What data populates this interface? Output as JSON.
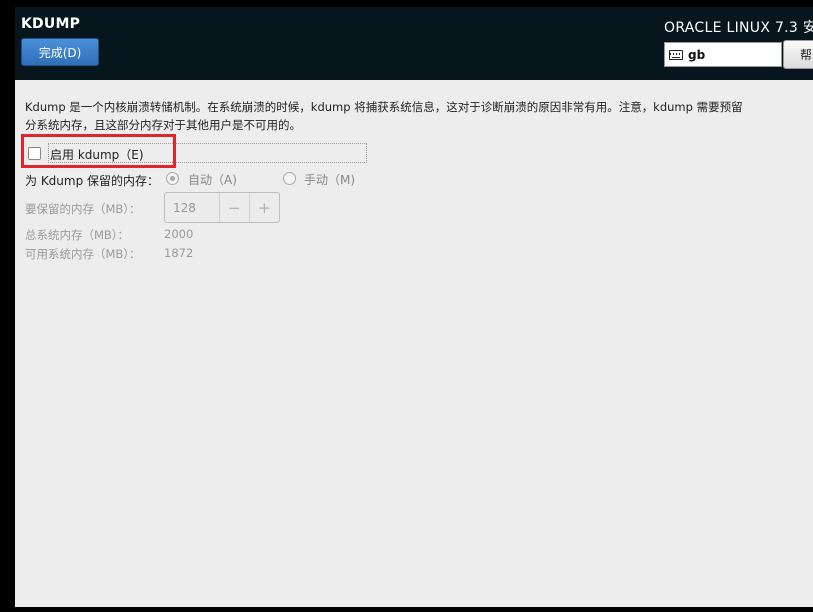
{
  "header": {
    "title": "KDUMP",
    "done_label": "完成(D)",
    "product_title": "ORACLE LINUX 7.3 安",
    "keyboard_layout": "gb",
    "help_label": "帮"
  },
  "description": {
    "line1": "Kdump 是一个内核崩溃转储机制。在系统崩溃的时候，kdump 将捕获系统信息，这对于诊断崩溃的原因非常有用。注意，kdump 需要预留",
    "line2": "分系统内存，且这部分内存对于其他用户是不可用的。"
  },
  "enable": {
    "label": "启用 kdump（E)",
    "checked": false
  },
  "memory_reservation": {
    "label": "为 Kdump 保留的内存：",
    "options": [
      {
        "label": "自动（A)",
        "selected": true
      },
      {
        "label": "手动（M)",
        "selected": false
      }
    ]
  },
  "reserved_memory": {
    "label": "要保留的内存（MB）：",
    "value": "128",
    "decrement": "−",
    "increment": "+"
  },
  "total_memory": {
    "label": "总系统内存（MB）：",
    "value": "2000"
  },
  "usable_memory": {
    "label": "可用系统内存（MB）：",
    "value": "1872"
  },
  "colors": {
    "header_bg": "#07151d",
    "accent": "#3a7fca",
    "highlight": "#e0262d",
    "window_bg": "#ededed"
  }
}
